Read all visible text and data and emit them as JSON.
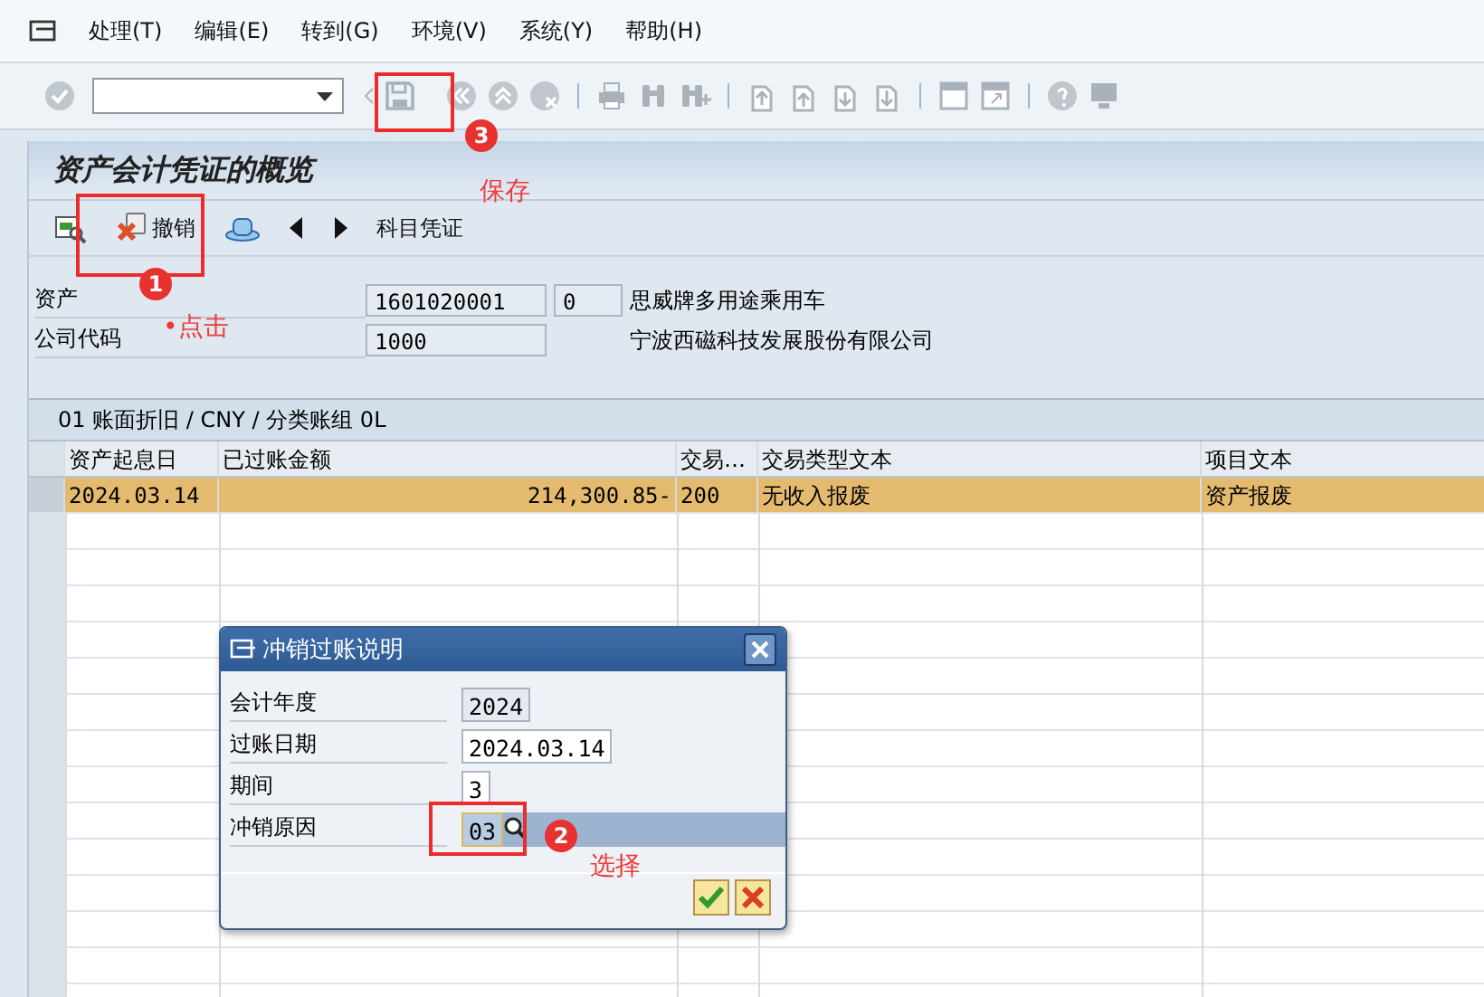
{
  "menu": [
    {
      "label": "处理(T)"
    },
    {
      "label": "编辑(E)"
    },
    {
      "label": "转到(G)"
    },
    {
      "label": "环境(V)"
    },
    {
      "label": "系统(Y)"
    },
    {
      "label": "帮助(H)"
    }
  ],
  "screen_title": "资产会计凭证的概览",
  "app_toolbar": [
    {
      "kind": "display"
    },
    {
      "kind": "labeled",
      "label": "撤销"
    },
    {
      "kind": "hat"
    },
    {
      "kind": "prev"
    },
    {
      "kind": "next"
    },
    {
      "kind": "text",
      "label": "科目凭证"
    }
  ],
  "fields": [
    {
      "label": "资产",
      "values": [
        "1601020001",
        "0"
      ],
      "description": "思威牌多用途乘用车"
    },
    {
      "label": "公司代码",
      "values": [
        "1000"
      ],
      "description": "宁波西磁科技发展股份有限公司"
    }
  ],
  "table": {
    "title": "01 账面折旧 / CNY / 分类账组 0L",
    "columns": [
      "资产起息日",
      "已过账金额",
      "交易…",
      "交易类型文本",
      "项目文本"
    ],
    "rows": [
      {
        "selected": true,
        "cells": [
          "2024.03.14",
          "214,300.85-",
          "200",
          "无收入报废",
          "资产报废"
        ]
      }
    ]
  },
  "dialog": {
    "title": "冲销过账说明",
    "fields": [
      {
        "label": "会计年度",
        "value": "2024",
        "kind": "readonly"
      },
      {
        "label": "过账日期",
        "value": "2024.03.14",
        "kind": "input"
      },
      {
        "label": "期间",
        "value": "3",
        "kind": "input"
      },
      {
        "label": "冲销原因",
        "value": "03",
        "kind": "search"
      }
    ]
  },
  "annotations": [
    {
      "kind": "box"
    },
    {
      "kind": "badge",
      "text": "3"
    },
    {
      "kind": "note",
      "text": "保存"
    },
    {
      "kind": "box"
    },
    {
      "kind": "badge",
      "text": "1"
    },
    {
      "kind": "note",
      "text": "•点击"
    },
    {
      "kind": "box"
    },
    {
      "kind": "badge",
      "text": "2"
    },
    {
      "kind": "note",
      "text": "选择"
    }
  ]
}
